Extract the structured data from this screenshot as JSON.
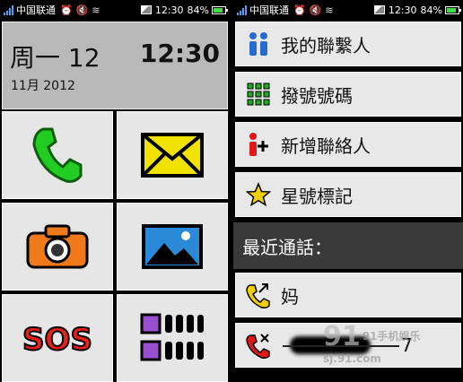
{
  "statusbar": {
    "carrier": "中国联通",
    "time": "12:30",
    "battery": "84%",
    "battery_level": 0.84
  },
  "left": {
    "clock": {
      "day": "周一 12",
      "time": "12:30",
      "date": "11月 2012"
    },
    "tiles": [
      {
        "icon": "phone-icon",
        "color": "#22cc22"
      },
      {
        "icon": "envelope-icon",
        "color": "#f2e200"
      },
      {
        "icon": "camera-icon",
        "color": "#f07a1a"
      },
      {
        "icon": "gallery-icon",
        "color": "#2a8ad8"
      },
      {
        "icon": "sos-icon",
        "label": "SOS",
        "color": "#e8201c"
      },
      {
        "icon": "apps-grid-icon",
        "color": "#9a4ed0"
      }
    ]
  },
  "right": {
    "menu": [
      {
        "label": "我的聯繫人",
        "icon": "contacts-icon"
      },
      {
        "label": "撥號號碼",
        "icon": "dialpad-icon"
      },
      {
        "label": "新增聯絡人",
        "icon": "add-contact-icon"
      },
      {
        "label": "星號標記",
        "icon": "star-icon"
      }
    ],
    "recent_header": "最近通話：",
    "recent_calls": [
      {
        "name": "妈",
        "icon": "outgoing-call-icon"
      },
      {
        "name": "7",
        "icon": "missed-call-icon"
      }
    ]
  },
  "watermark": {
    "brand": "91手机娱乐",
    "site": "sj.91.com",
    "mark": "91"
  }
}
